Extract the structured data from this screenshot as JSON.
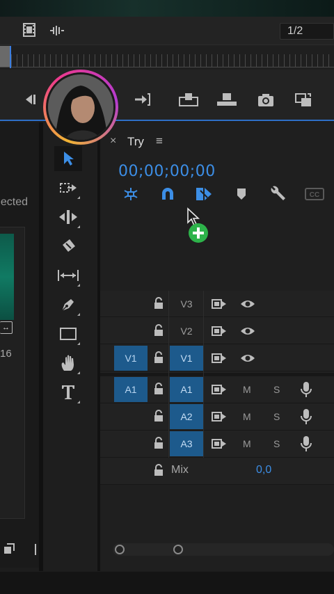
{
  "toolbar": {
    "zoom_label": "1/2"
  },
  "left_panel": {
    "partial_label": "ected",
    "clip_badge": "↔",
    "clip_number": "16"
  },
  "timeline": {
    "tab_close": "×",
    "sequence_name": "Try",
    "menu_icon": "≡",
    "timecode": "00;00;00;00",
    "tracks": {
      "video": [
        {
          "name": "V3",
          "source": ""
        },
        {
          "name": "V2",
          "source": ""
        },
        {
          "name": "V1",
          "source": "V1"
        }
      ],
      "audio": [
        {
          "name": "A1",
          "source": "A1",
          "mute": "M",
          "solo": "S"
        },
        {
          "name": "A2",
          "source": "",
          "mute": "M",
          "solo": "S"
        },
        {
          "name": "A3",
          "source": "",
          "mute": "M",
          "solo": "S"
        }
      ],
      "mix_label": "Mix",
      "mix_value": "0,0"
    }
  },
  "colors": {
    "accent": "#3c8ee6",
    "track_highlight": "#1d5a8c",
    "add_cursor": "#2db34a"
  }
}
